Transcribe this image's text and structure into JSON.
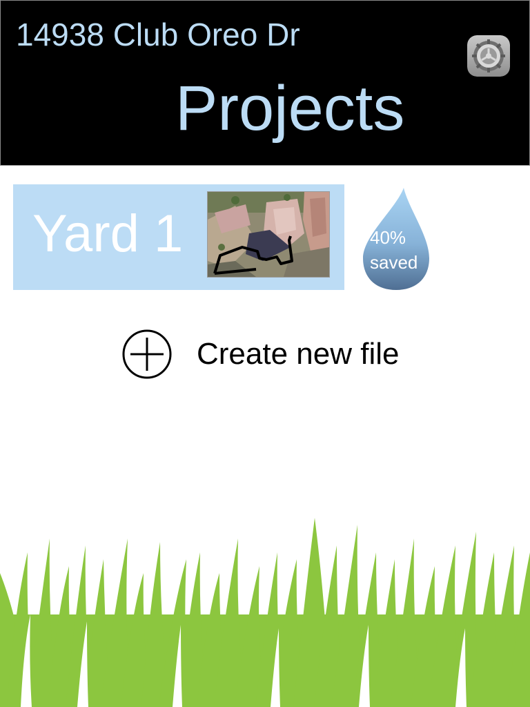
{
  "header": {
    "address": "14938 Club Oreo Dr",
    "title": "Projects",
    "settings_icon": "gear-icon"
  },
  "projects": [
    {
      "name": "Yard 1",
      "thumbnail": "aerial-yard-thumbnail",
      "savings_line1": "40%",
      "savings_line2": "saved",
      "savings_percent": 40
    }
  ],
  "actions": {
    "create_new_label": "Create new file",
    "create_new_icon": "plus-circle-icon"
  },
  "colors": {
    "header_bg": "#000000",
    "header_text": "#bcdcf5",
    "card_bg": "#bcdcf5",
    "drop_top": "#a9d4f3",
    "drop_bottom": "#4f6f93",
    "grass": "#8cc63f"
  }
}
